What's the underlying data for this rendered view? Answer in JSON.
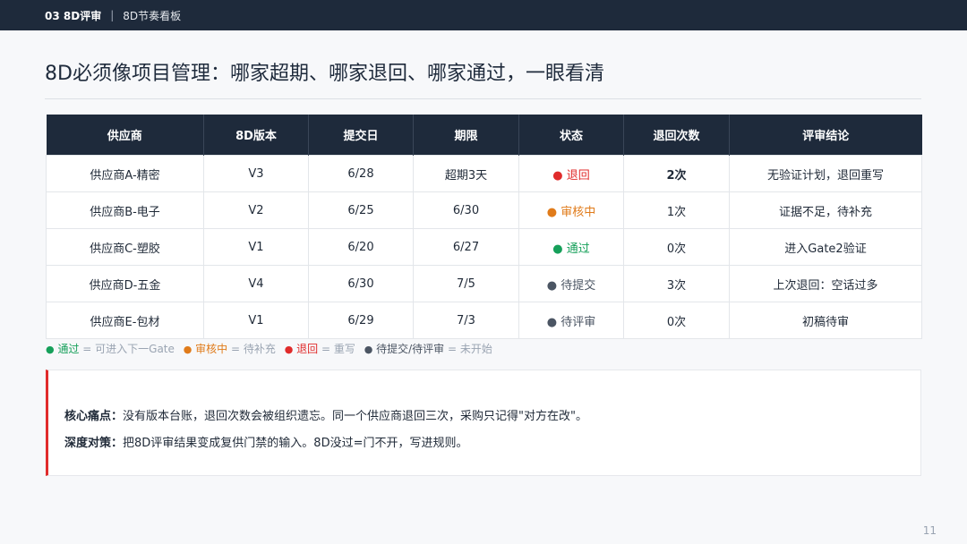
{
  "header": {
    "section": "03 8D评审",
    "separator": "|",
    "subtitle": "8D节奏看板"
  },
  "title": "8D必须像项目管理：哪家超期、哪家退回、哪家通过，一眼看清",
  "table": {
    "columns": [
      "供应商",
      "8D版本",
      "提交日",
      "期限",
      "状态",
      "退回次数",
      "评审结论"
    ],
    "rows": [
      {
        "supplier": "供应商A-精密",
        "version": "V3",
        "submitted": "6/28",
        "deadline": "超期3天",
        "status": "退回",
        "returns": "2次",
        "conclusion": "无验证计划，退回重写"
      },
      {
        "supplier": "供应商B-电子",
        "version": "V2",
        "submitted": "6/25",
        "deadline": "6/30",
        "status": "审核中",
        "returns": "1次",
        "conclusion": "证据不足，待补充"
      },
      {
        "supplier": "供应商C-塑胶",
        "version": "V1",
        "submitted": "6/20",
        "deadline": "6/27",
        "status": "通过",
        "returns": "0次",
        "conclusion": "进入Gate2验证"
      },
      {
        "supplier": "供应商D-五金",
        "version": "V4",
        "submitted": "6/30",
        "deadline": "7/5",
        "status": "待提交",
        "returns": "3次",
        "conclusion": "上次退回：空话过多"
      },
      {
        "supplier": "供应商E-包材",
        "version": "V1",
        "submitted": "6/29",
        "deadline": "7/3",
        "status": "待评审",
        "returns": "0次",
        "conclusion": "初稿待审"
      }
    ]
  },
  "status_dot": "●",
  "legend": {
    "pass": "通过",
    "pass_desc": "= 可进入下一Gate",
    "review": "审核中",
    "review_desc": "= 待补充",
    "rejected": "退回",
    "rejected_desc": "= 重写",
    "pending": "待提交/待评审",
    "pending_desc": "= 未开始"
  },
  "callout": {
    "pain_label": "核心痛点：",
    "pain_text": "没有版本台账，退回次数会被组织遗忘。同一个供应商退回三次，采购只记得\"对方在改\"。",
    "strategy_label": "深度对策：",
    "strategy_text": "把8D评审结果变成复供门禁的输入。8D没过=门不开，写进规则。"
  },
  "page_number": "11",
  "colors": {
    "header_bg": "#1e2a3b",
    "red": "#e02b2b",
    "orange": "#e07b1a",
    "green": "#16a05a",
    "gray": "#4b5563"
  }
}
